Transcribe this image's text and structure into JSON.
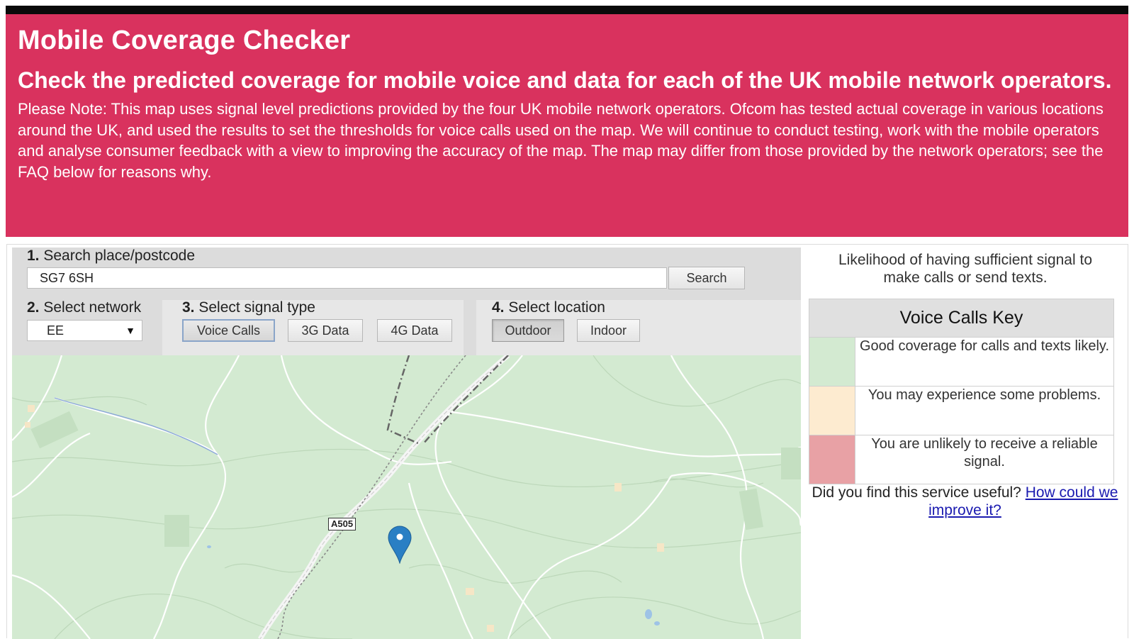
{
  "header": {
    "title": "Mobile Coverage Checker",
    "subtitle": "Check the predicted coverage for mobile voice and data for each of the UK mobile network operators.",
    "note": "Please Note: This map uses signal level predictions provided by the four UK mobile network operators. Ofcom has tested actual coverage in various locations around the UK, and used the results to set the thresholds for voice calls used on the map. We will continue to conduct testing, work with the mobile operators and analyse consumer feedback with a view to improving the accuracy of the map. The map may differ from those provided by the network operators; see the FAQ below for reasons why."
  },
  "search": {
    "step_number": "1.",
    "label": "Search place/postcode",
    "value": "SG7 6SH",
    "button": "Search"
  },
  "network": {
    "step_number": "2.",
    "label": "Select network",
    "selected": "EE"
  },
  "signal": {
    "step_number": "3.",
    "label": "Select signal type",
    "options": [
      "Voice Calls",
      "3G Data",
      "4G Data"
    ],
    "selected": "Voice Calls"
  },
  "location": {
    "step_number": "4.",
    "label": "Select location",
    "options": [
      "Outdoor",
      "Indoor"
    ],
    "selected": "Outdoor"
  },
  "map": {
    "road_label": "A505",
    "marker": "map-pin-icon"
  },
  "key": {
    "intro": "Likelihood of having sufficient signal to make calls or send texts.",
    "title": "Voice Calls Key",
    "rows": [
      {
        "color": "#d3ead1",
        "text": "Good coverage for calls and texts likely."
      },
      {
        "color": "#fdebd0",
        "text": "You may experience some problems."
      },
      {
        "color": "#e8a1a5",
        "text": "You are unlikely to receive a reliable signal."
      }
    ]
  },
  "feedback": {
    "question": "Did you find this service useful?",
    "link": "How could we improve it?"
  },
  "colors": {
    "banner": "#d9325e",
    "map_bg": "#d3ead1",
    "marker": "#2a7fc4"
  }
}
